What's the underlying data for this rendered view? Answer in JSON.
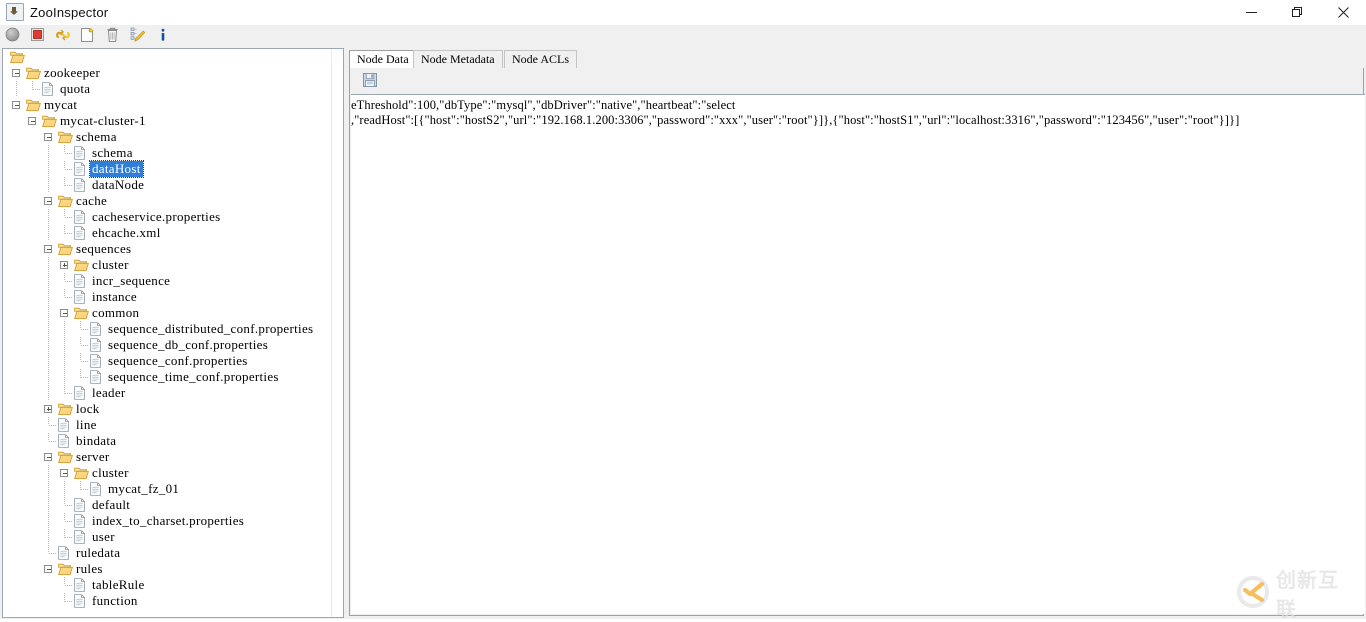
{
  "window": {
    "title": "ZooInspector",
    "icon": "java-app-icon",
    "controls": [
      {
        "name": "minimize-button",
        "glyph": "minimize-icon"
      },
      {
        "name": "restore-button",
        "glyph": "restore-icon"
      },
      {
        "name": "close-button",
        "glyph": "close-icon"
      }
    ]
  },
  "toolbar": {
    "buttons": [
      {
        "name": "connect-button",
        "icon": "gray-circle-icon",
        "tooltip": "Connect"
      },
      {
        "name": "disconnect-button",
        "icon": "red-square-icon",
        "tooltip": "Disconnect"
      },
      {
        "name": "refresh-button",
        "icon": "yellow-link-refresh-icon",
        "tooltip": "Refresh"
      },
      {
        "name": "add-node-button",
        "icon": "new-document-icon",
        "tooltip": "Add Node"
      },
      {
        "name": "delete-node-button",
        "icon": "trash-can-icon",
        "tooltip": "Delete Node"
      },
      {
        "name": "edit-node-button",
        "icon": "edit-tree-pencil-icon",
        "tooltip": "Edit Node"
      },
      {
        "name": "about-button",
        "icon": "info-i-icon",
        "tooltip": "About"
      }
    ]
  },
  "tree": {
    "root_icon": "open-folder-icon",
    "selected": "dataHost",
    "nodes": [
      {
        "label": "",
        "depth": 0,
        "type": "folder",
        "state": "none"
      },
      {
        "label": "zookeeper",
        "depth": 1,
        "type": "folder",
        "state": "expanded"
      },
      {
        "label": "quota",
        "depth": 2,
        "type": "file",
        "state": "leaf"
      },
      {
        "label": "mycat",
        "depth": 1,
        "type": "folder",
        "state": "expanded"
      },
      {
        "label": "mycat-cluster-1",
        "depth": 2,
        "type": "folder",
        "state": "expanded"
      },
      {
        "label": "schema",
        "depth": 3,
        "type": "folder",
        "state": "expanded"
      },
      {
        "label": "schema",
        "depth": 4,
        "type": "file",
        "state": "leaf"
      },
      {
        "label": "dataHost",
        "depth": 4,
        "type": "file",
        "state": "leaf"
      },
      {
        "label": "dataNode",
        "depth": 4,
        "type": "file",
        "state": "leaf"
      },
      {
        "label": "cache",
        "depth": 3,
        "type": "folder",
        "state": "expanded"
      },
      {
        "label": "cacheservice.properties",
        "depth": 4,
        "type": "file",
        "state": "leaf"
      },
      {
        "label": "ehcache.xml",
        "depth": 4,
        "type": "file",
        "state": "leaf"
      },
      {
        "label": "sequences",
        "depth": 3,
        "type": "folder",
        "state": "expanded"
      },
      {
        "label": "cluster",
        "depth": 4,
        "type": "folder",
        "state": "collapsed"
      },
      {
        "label": "incr_sequence",
        "depth": 4,
        "type": "file",
        "state": "leaf"
      },
      {
        "label": "instance",
        "depth": 4,
        "type": "file",
        "state": "leaf"
      },
      {
        "label": "common",
        "depth": 4,
        "type": "folder",
        "state": "expanded"
      },
      {
        "label": "sequence_distributed_conf.properties",
        "depth": 5,
        "type": "file",
        "state": "leaf"
      },
      {
        "label": "sequence_db_conf.properties",
        "depth": 5,
        "type": "file",
        "state": "leaf"
      },
      {
        "label": "sequence_conf.properties",
        "depth": 5,
        "type": "file",
        "state": "leaf"
      },
      {
        "label": "sequence_time_conf.properties",
        "depth": 5,
        "type": "file",
        "state": "leaf"
      },
      {
        "label": "leader",
        "depth": 4,
        "type": "file",
        "state": "leaf"
      },
      {
        "label": "lock",
        "depth": 3,
        "type": "folder",
        "state": "collapsed"
      },
      {
        "label": "line",
        "depth": 3,
        "type": "file",
        "state": "leaf"
      },
      {
        "label": "bindata",
        "depth": 3,
        "type": "file",
        "state": "leaf"
      },
      {
        "label": "server",
        "depth": 3,
        "type": "folder",
        "state": "expanded"
      },
      {
        "label": "cluster",
        "depth": 4,
        "type": "folder",
        "state": "expanded"
      },
      {
        "label": "mycat_fz_01",
        "depth": 5,
        "type": "file",
        "state": "leaf"
      },
      {
        "label": "default",
        "depth": 4,
        "type": "file",
        "state": "leaf"
      },
      {
        "label": "index_to_charset.properties",
        "depth": 4,
        "type": "file",
        "state": "leaf"
      },
      {
        "label": "user",
        "depth": 4,
        "type": "file",
        "state": "leaf"
      },
      {
        "label": "ruledata",
        "depth": 3,
        "type": "file",
        "state": "leaf"
      },
      {
        "label": "rules",
        "depth": 3,
        "type": "folder",
        "state": "expanded"
      },
      {
        "label": "tableRule",
        "depth": 4,
        "type": "file",
        "state": "leaf"
      },
      {
        "label": "function",
        "depth": 4,
        "type": "file",
        "state": "leaf"
      }
    ]
  },
  "right": {
    "tabs": [
      {
        "label": "Node Data",
        "active": true
      },
      {
        "label": "Node Metadata",
        "active": false
      },
      {
        "label": "Node ACLs",
        "active": false
      }
    ],
    "save_button": {
      "name": "save-node-data-button",
      "icon": "floppy-disk-save-icon"
    },
    "node_data": "eThreshold\":100,\"dbType\":\"mysql\",\"dbDriver\":\"native\",\"heartbeat\":\"select\n,\"readHost\":[{\"host\":\"hostS2\",\"url\":\"192.168.1.200:3306\",\"password\":\"xxx\",\"user\":\"root\"}]},{\"host\":\"hostS1\",\"url\":\"localhost:3316\",\"password\":\"123456\",\"user\":\"root\"}]}]"
  },
  "watermark": {
    "text": "创新互联",
    "logo": "circle-check-logo-icon",
    "colors": {
      "ring": "#dedede",
      "mark": "#f5a623"
    }
  },
  "colors": {
    "selection": "#2f7fd8",
    "folder": "#f0b43c",
    "chrome": "#f0f0f0",
    "border": "#9ba7b3"
  }
}
